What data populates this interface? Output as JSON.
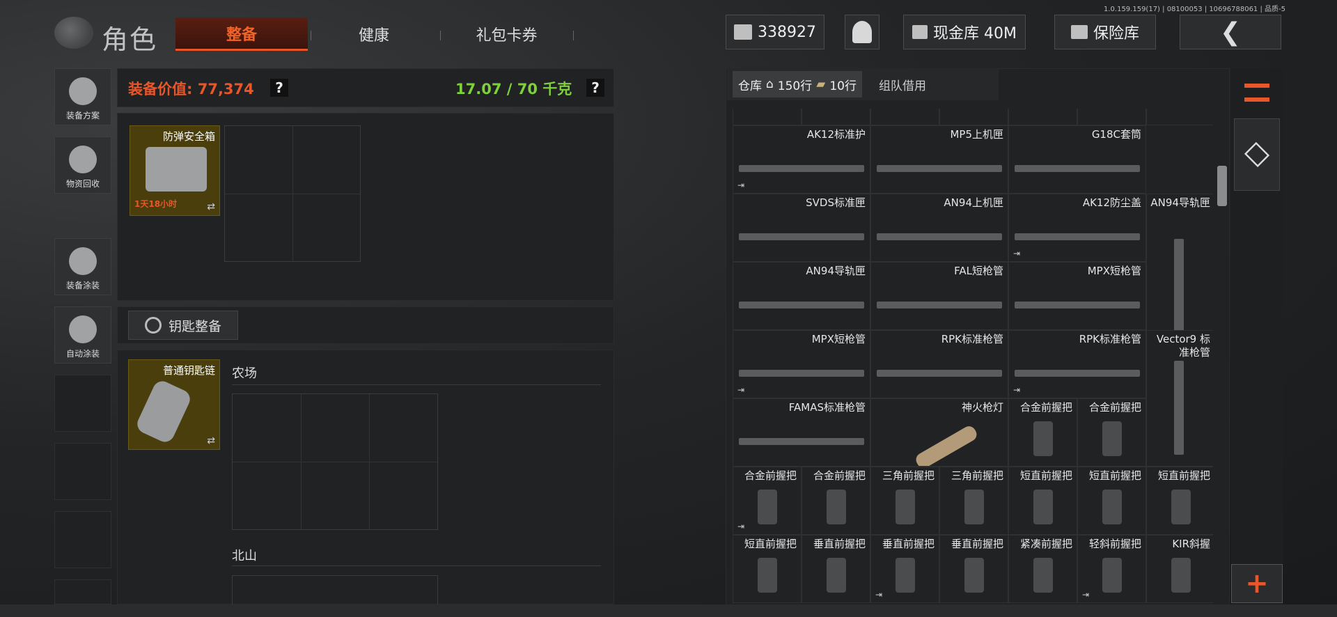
{
  "version": "1.0.159.159(17) | 08100053 | 10696788061 | 品质-5",
  "header": {
    "title": "角色",
    "tabs": [
      "整备",
      "健康",
      "礼包卡券"
    ],
    "money": "338927",
    "cash_vault": "现金库 40M",
    "safe_vault": "保险库",
    "back_icon": "chevron-left-icon"
  },
  "sidebar": {
    "items": [
      "装备方案",
      "物资回收",
      "装备涂装",
      "自动涂装"
    ]
  },
  "equipment": {
    "value_label": "装备价值:",
    "value": "77,374",
    "weight": "17.07 / 70 千克",
    "help": "?",
    "safe_box": {
      "name": "防弹安全箱",
      "timer": "1天18小时"
    },
    "keys_button": "钥匙整备",
    "keychain": {
      "name": "普通钥匙链"
    },
    "key_sections": [
      "农场",
      "北山"
    ]
  },
  "warehouse": {
    "tab_label": "仓库",
    "rows_home": "150行",
    "rows_extra": "10行",
    "team_tab": "组队借用",
    "items": [
      {
        "name": "AK12标准护",
        "exit": true
      },
      {
        "name": "MP5上机匣",
        "exit": false
      },
      {
        "name": "G18C套筒",
        "exit": false
      },
      {
        "name": "SVDS标准匣",
        "exit": false
      },
      {
        "name": "AN94上机匣",
        "exit": false
      },
      {
        "name": "AK12防尘盖",
        "exit": true
      },
      {
        "name": "AN94导轨匣",
        "exit": false
      },
      {
        "name": "AN94导轨匣",
        "exit": false
      },
      {
        "name": "FAL短枪管",
        "exit": false
      },
      {
        "name": "MPX短枪管",
        "exit": false
      },
      {
        "name": "MPX短枪管",
        "exit": true
      },
      {
        "name": "RPK标准枪管",
        "exit": false
      },
      {
        "name": "RPK标准枪管",
        "exit": true
      },
      {
        "name": "Vector9 标准枪管",
        "exit": false
      },
      {
        "name": "FAMAS标准枪管",
        "exit": false
      },
      {
        "name": "神火枪灯",
        "exit": false
      },
      {
        "name": "合金前握把",
        "exit": false
      },
      {
        "name": "合金前握把",
        "exit": false
      },
      {
        "name": "合金前握把",
        "exit": true
      },
      {
        "name": "合金前握把",
        "exit": false
      },
      {
        "name": "三角前握把",
        "exit": false
      },
      {
        "name": "三角前握把",
        "exit": false
      },
      {
        "name": "短直前握把",
        "exit": false
      },
      {
        "name": "短直前握把",
        "exit": false
      },
      {
        "name": "短直前握把",
        "exit": false
      },
      {
        "name": "短直前握把",
        "exit": false
      },
      {
        "name": "垂直前握把",
        "exit": false
      },
      {
        "name": "垂直前握把",
        "exit": true
      },
      {
        "name": "垂直前握把",
        "exit": false
      },
      {
        "name": "紧凑前握把",
        "exit": false
      },
      {
        "name": "轻斜前握把",
        "exit": true
      },
      {
        "name": "KIR斜握",
        "exit": false
      }
    ]
  },
  "colors": {
    "accent": "#e8562a",
    "weight_green": "#7fd13b",
    "item_gold": "#4a3e0c"
  }
}
